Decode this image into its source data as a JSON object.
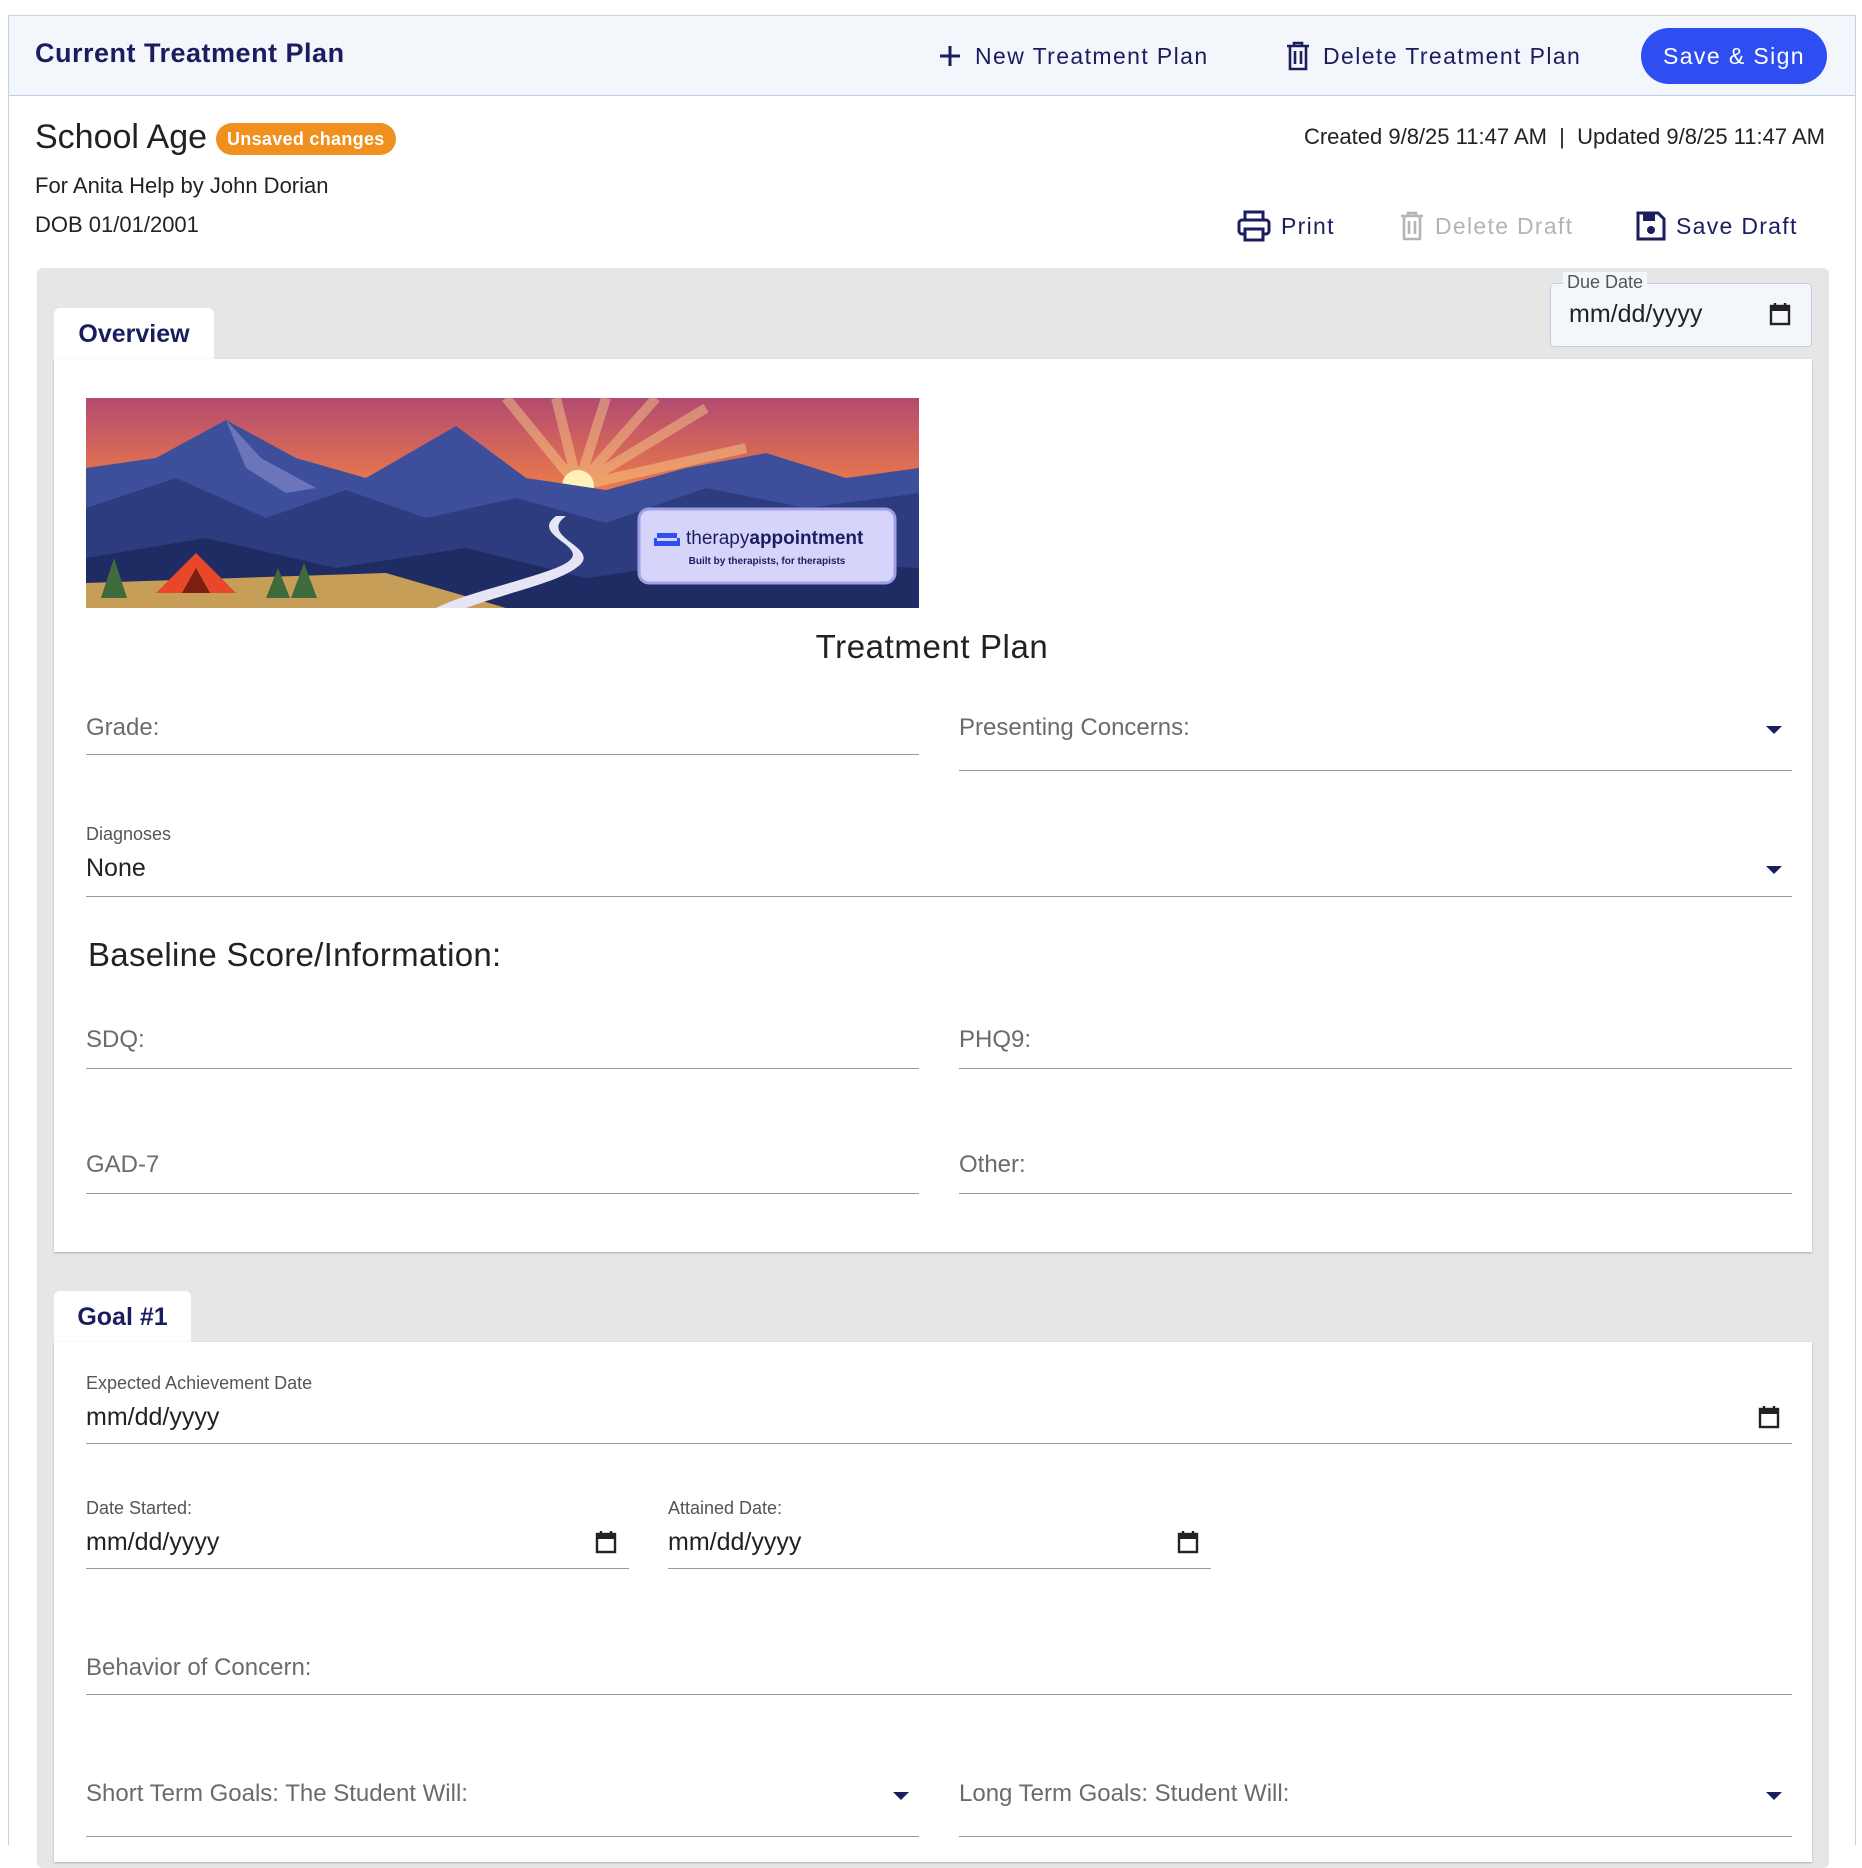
{
  "header": {
    "title": "Current Treatment Plan",
    "new_plan_label": "New Treatment Plan",
    "delete_plan_label": "Delete Treatment Plan",
    "save_sign_label": "Save & Sign"
  },
  "plan": {
    "name": "School Age",
    "badge": "Unsaved changes",
    "for_line": "For Anita Help by John Dorian",
    "dob": "DOB 01/01/2001",
    "meta": "Created 9/8/25 11:47 AM  |  Updated 9/8/25 11:47 AM"
  },
  "actions": {
    "print": "Print",
    "delete_draft": "Delete Draft",
    "save_draft": "Save Draft"
  },
  "due_date": {
    "label": "Due Date",
    "value": "mm/dd/yyyy"
  },
  "overview": {
    "tab": "Overview",
    "banner": {
      "brand_prefix": "therapy",
      "brand_suffix": "appointment",
      "tagline": "Built by therapists, for therapists"
    },
    "title": "Treatment Plan",
    "grade_placeholder": "Grade:",
    "concerns_placeholder": "Presenting Concerns:",
    "diagnoses_label": "Diagnoses",
    "diagnoses_value": "None",
    "baseline_heading": "Baseline Score/Information:",
    "sdq": "SDQ:",
    "phq9": "PHQ9:",
    "gad7": "GAD-7",
    "other": "Other:"
  },
  "goal1": {
    "tab": "Goal #1",
    "expected_label": "Expected Achievement Date",
    "expected_value": "mm/dd/yyyy",
    "started_label": "Date Started:",
    "started_value": "mm/dd/yyyy",
    "attained_label": "Attained Date:",
    "attained_value": "mm/dd/yyyy",
    "behavior_placeholder": "Behavior of Concern:",
    "short_term_placeholder": "Short Term Goals: The Student Will:",
    "long_term_placeholder": "Long Term Goals: Student Will:"
  },
  "colors": {
    "primary": "#2e4ef2",
    "navy": "#1b1e5e",
    "badge": "#f0901e",
    "disabled": "#b4b4b4"
  }
}
